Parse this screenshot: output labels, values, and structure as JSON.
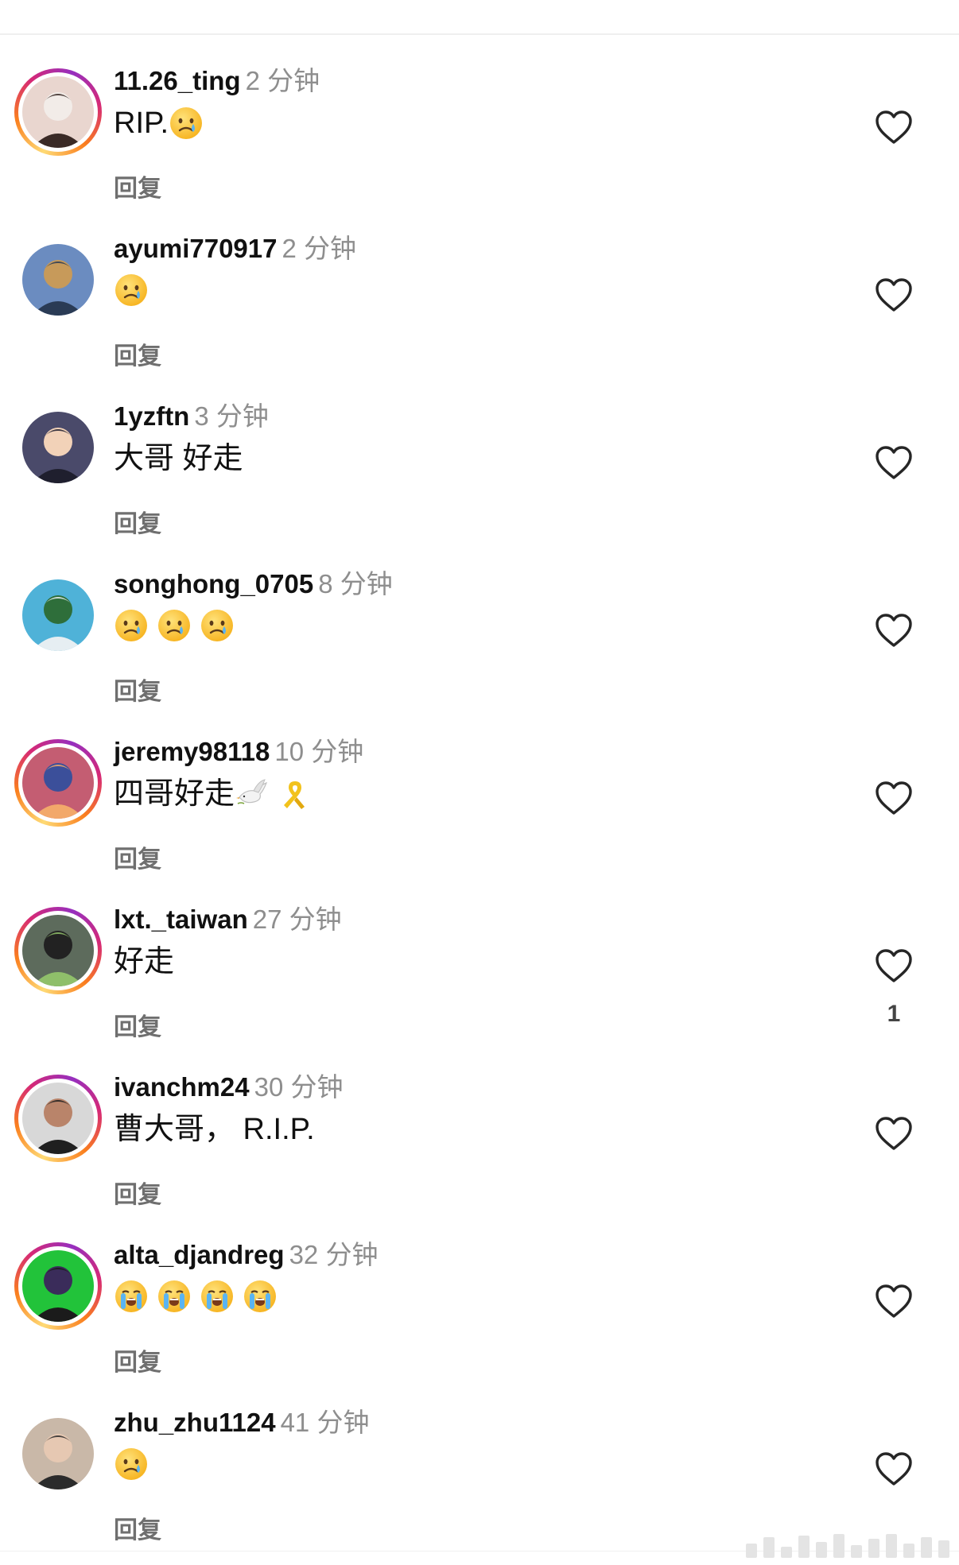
{
  "comments": [
    {
      "username": "11.26_ting",
      "time": "2 分钟",
      "text_parts": [
        {
          "t": "RIP."
        },
        {
          "e": "crying"
        }
      ],
      "reply": "回复",
      "likes": "",
      "avatar": {
        "story": true,
        "bg": "#e9d6cf",
        "fg": "#f2ece8",
        "accent": "#3a2a26"
      }
    },
    {
      "username": "ayumi770917",
      "time": "2 分钟",
      "text_parts": [
        {
          "e": "crying"
        }
      ],
      "reply": "回复",
      "likes": "",
      "avatar": {
        "story": false,
        "bg": "#6b8cc0",
        "fg": "#c79a5a",
        "accent": "#2a3b55"
      }
    },
    {
      "username": "1yzftn",
      "time": "3 分钟",
      "text_parts": [
        {
          "t": "大哥 好走"
        }
      ],
      "reply": "回复",
      "likes": "",
      "avatar": {
        "story": false,
        "bg": "#4a4a6a",
        "fg": "#f2d2b8",
        "accent": "#1f1f2e"
      }
    },
    {
      "username": "songhong_0705",
      "time": "8 分钟",
      "text_parts": [
        {
          "e": "crying"
        },
        {
          "e": "crying"
        },
        {
          "e": "crying"
        }
      ],
      "reply": "回复",
      "likes": "",
      "avatar": {
        "story": false,
        "bg": "#4fb2d8",
        "fg": "#2e6e3a",
        "accent": "#e6eef2"
      }
    },
    {
      "username": "jeremy98118",
      "time": "10 分钟",
      "text_parts": [
        {
          "t": "四哥好走"
        },
        {
          "e": "dove"
        },
        {
          "e": "ribbon"
        }
      ],
      "reply": "回复",
      "likes": "",
      "avatar": {
        "story": true,
        "bg": "#c45d72",
        "fg": "#3b4f9a",
        "accent": "#f2a86a"
      }
    },
    {
      "username": "lxt._taiwan",
      "time": "27 分钟",
      "text_parts": [
        {
          "t": "好走"
        }
      ],
      "reply": "回复",
      "likes": "1",
      "avatar": {
        "story": true,
        "bg": "#5d6b5c",
        "fg": "#222222",
        "accent": "#8fbf6a"
      }
    },
    {
      "username": "ivanchm24",
      "time": "30 分钟",
      "text_parts": [
        {
          "t": "曹大哥， R.I.P."
        }
      ],
      "reply": "回复",
      "likes": "",
      "avatar": {
        "story": true,
        "bg": "#d8d8d8",
        "fg": "#b9846a",
        "accent": "#1f1f1f"
      }
    },
    {
      "username": "alta_djandreg",
      "time": "32 分钟",
      "text_parts": [
        {
          "e": "loudly-crying"
        },
        {
          "e": "loudly-crying"
        },
        {
          "e": "loudly-crying"
        },
        {
          "e": "loudly-crying"
        }
      ],
      "reply": "回复",
      "likes": "",
      "avatar": {
        "story": true,
        "bg": "#22c33a",
        "fg": "#3a2c5a",
        "accent": "#1b1b1b"
      }
    },
    {
      "username": "zhu_zhu1124",
      "time": "41 分钟",
      "text_parts": [
        {
          "e": "crying"
        }
      ],
      "reply": "回复",
      "likes": "",
      "avatar": {
        "story": false,
        "bg": "#c9b8a8",
        "fg": "#e6c8b2",
        "accent": "#2b2b2b"
      }
    }
  ]
}
